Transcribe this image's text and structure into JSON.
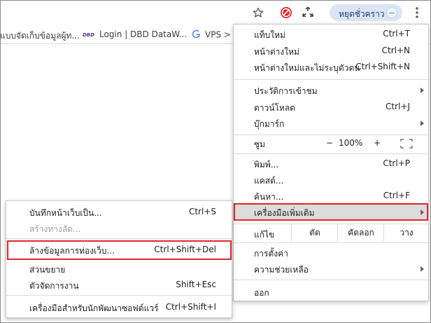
{
  "toolbar": {
    "profile_label": "หยุดชั่วคราว"
  },
  "bookmarks": [
    {
      "label": "แบบจัดเก็บข้อมูลผู้ท..."
    },
    {
      "label": "Login | DBD DataW..."
    },
    {
      "label": "VPS >"
    }
  ],
  "menu": {
    "new_tab": {
      "label": "แท็บใหม่",
      "shortcut": "Ctrl+T"
    },
    "new_window": {
      "label": "หน้าต่างใหม่",
      "shortcut": "Ctrl+N"
    },
    "incognito": {
      "label": "หน้าต่างใหม่และไม่ระบุตัวตน",
      "shortcut": "Ctrl+Shift+N"
    },
    "history": {
      "label": "ประวัติการเข้าชม"
    },
    "downloads": {
      "label": "ดาวน์โหลด",
      "shortcut": "Ctrl+J"
    },
    "bookmarks": {
      "label": "บุ๊กมาร์ก"
    },
    "zoom": {
      "label": "ซูม",
      "minus": "−",
      "value": "100%",
      "plus": "+"
    },
    "print": {
      "label": "พิมพ์...",
      "shortcut": "Ctrl+P"
    },
    "cast": {
      "label": "แคสต์..."
    },
    "find": {
      "label": "ค้นหา...",
      "shortcut": "Ctrl+F"
    },
    "more_tools": {
      "label": "เครื่องมือเพิ่มเติม"
    },
    "edit": {
      "label": "แก้ไข",
      "cut": "ตัด",
      "copy": "คัดลอก",
      "paste": "วาง"
    },
    "settings": {
      "label": "การตั้งค่า"
    },
    "help": {
      "label": "ความช่วยเหลือ"
    },
    "exit": {
      "label": "ออก"
    }
  },
  "submenu": {
    "save_page": {
      "label": "บันทึกหน้าเว็บเป็น...",
      "shortcut": "Ctrl+S"
    },
    "create_shortcut": {
      "label": "สร้างทางลัด..."
    },
    "clear_data": {
      "label": "ล้างข้อมูลการท่องเว็บ...",
      "shortcut": "Ctrl+Shift+Del"
    },
    "extensions": {
      "label": "ส่วนขยาย"
    },
    "task_manager": {
      "label": "ตัวจัดการงาน",
      "shortcut": "Shift+Esc"
    },
    "dev_tools": {
      "label": "เครื่องมือสำหรับนักพัฒนาซอฟต์แวร์",
      "shortcut": "Ctrl+Shift+I"
    }
  },
  "colors": {
    "highlight_border": "#e0282e",
    "hover_bg": "#dcdcdc",
    "profile_chip": "#dbe5f6"
  }
}
